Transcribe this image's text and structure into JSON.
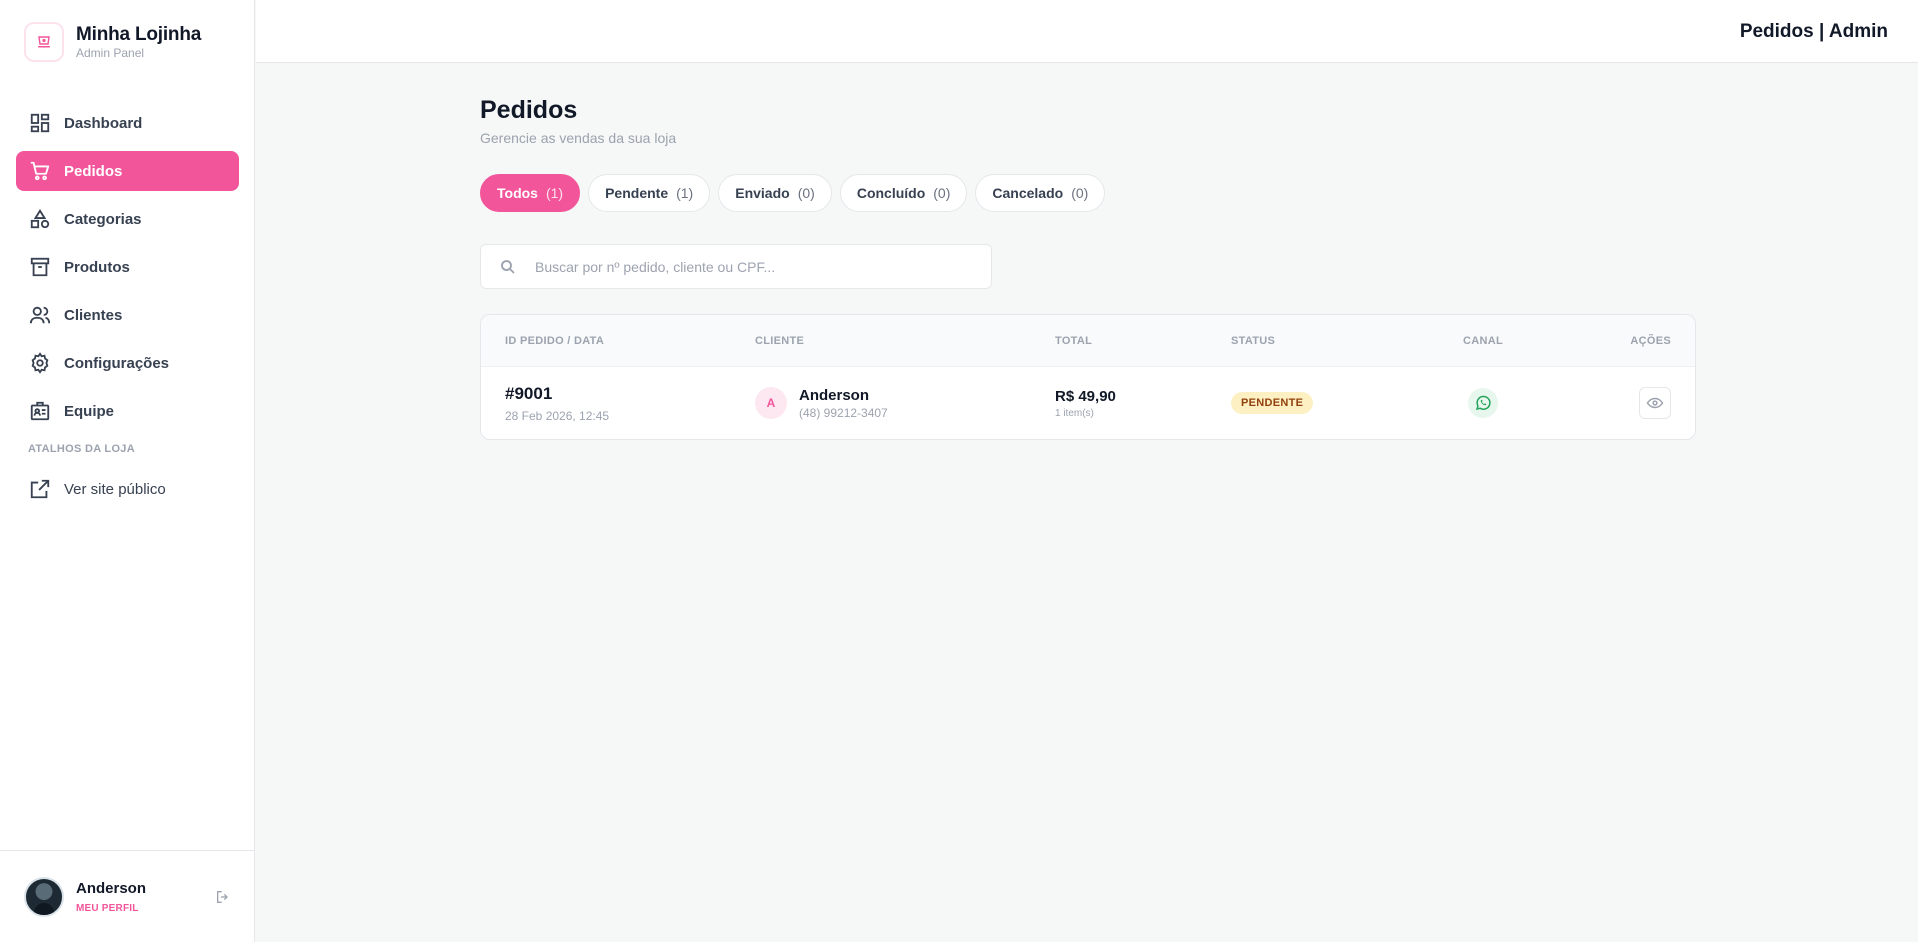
{
  "brand": {
    "name": "Minha Lojinha",
    "subtitle": "Admin Panel"
  },
  "sidebar": {
    "items": [
      {
        "label": "Dashboard",
        "icon": "dashboard-icon",
        "active": false
      },
      {
        "label": "Pedidos",
        "icon": "cart-icon",
        "active": true
      },
      {
        "label": "Categorias",
        "icon": "shapes-icon",
        "active": false
      },
      {
        "label": "Produtos",
        "icon": "archive-icon",
        "active": false
      },
      {
        "label": "Clientes",
        "icon": "users-icon",
        "active": false
      },
      {
        "label": "Configurações",
        "icon": "gear-icon",
        "active": false
      },
      {
        "label": "Equipe",
        "icon": "badge-icon",
        "active": false
      }
    ],
    "section_label": "ATALHOS DA LOJA",
    "shortcut_label": "Ver site público"
  },
  "profile": {
    "name": "Anderson",
    "link_label": "MEU PERFIL"
  },
  "topbar": {
    "title": "Pedidos | Admin"
  },
  "page": {
    "title": "Pedidos",
    "subtitle": "Gerencie as vendas da sua loja"
  },
  "filters": [
    {
      "label": "Todos",
      "count": "(1)",
      "active": true
    },
    {
      "label": "Pendente",
      "count": "(1)",
      "active": false
    },
    {
      "label": "Enviado",
      "count": "(0)",
      "active": false
    },
    {
      "label": "Concluído",
      "count": "(0)",
      "active": false
    },
    {
      "label": "Cancelado",
      "count": "(0)",
      "active": false
    }
  ],
  "search": {
    "placeholder": "Buscar por nº pedido, cliente ou CPF...",
    "value": ""
  },
  "table": {
    "headers": {
      "id": "ID PEDIDO / DATA",
      "client": "CLIENTE",
      "total": "TOTAL",
      "status": "STATUS",
      "channel": "CANAL",
      "actions": "AÇÕES"
    },
    "rows": [
      {
        "id": "#9001",
        "date": "28 Feb 2026, 12:45",
        "client_initial": "A",
        "client_name": "Anderson",
        "client_phone": "(48) 99212-3407",
        "total": "R$ 49,90",
        "items": "1 item(s)",
        "status": "PENDENTE",
        "channel_icon": "whatsapp-icon",
        "action_icon": "eye-icon"
      }
    ]
  },
  "colors": {
    "accent": "#f2559a",
    "pending_bg": "#fdf0c2",
    "pending_text": "#92400e",
    "whatsapp": "#25a35a"
  }
}
